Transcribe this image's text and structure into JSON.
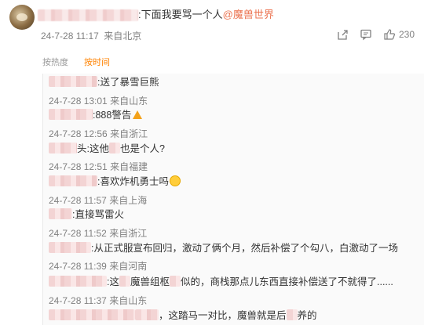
{
  "post": {
    "text": ":下面我要骂一个人",
    "mention": "@魔兽世界",
    "time": "24-7-28 11:17",
    "location": "来自北京",
    "like_count": "230",
    "icons": [
      "share-icon",
      "comment-icon",
      "like-icon"
    ]
  },
  "sort": {
    "by_heat": "按热度",
    "by_time": "按时间",
    "active": "by_time"
  },
  "replies": [
    {
      "text": ":送了暴雪巨熊",
      "time": "24-7-28 13:01",
      "location": "来自山东"
    },
    {
      "text": ":888警告",
      "time": "24-7-28 12:56",
      "location": "来自浙江"
    },
    {
      "text": "头:这他",
      "text2": "也是个人?",
      "time": "24-7-28 12:51",
      "location": "来自福建"
    },
    {
      "text": ":喜欢炸机勇士吗",
      "time": "24-7-28 11:57",
      "location": "来自上海"
    },
    {
      "text": ":直接骂雷火",
      "time": "24-7-28 11:52",
      "location": "来自浙江"
    },
    {
      "text": ":从正式服宣布回归，激动了俩个月，然后补偿了个勾八，白激动了一场",
      "time": "24-7-28 11:39",
      "location": "来自河南"
    },
    {
      "text": ":这",
      "text2": "魔兽组枢",
      "text3": "似的，商栈那点儿东西直接补偿送了不就得了......",
      "time": "24-7-28 11:37",
      "location": "来自山东"
    },
    {
      "text": "，这踏马一对比，魔兽就是后",
      "text2": "养的",
      "time": "",
      "location": ""
    }
  ]
}
